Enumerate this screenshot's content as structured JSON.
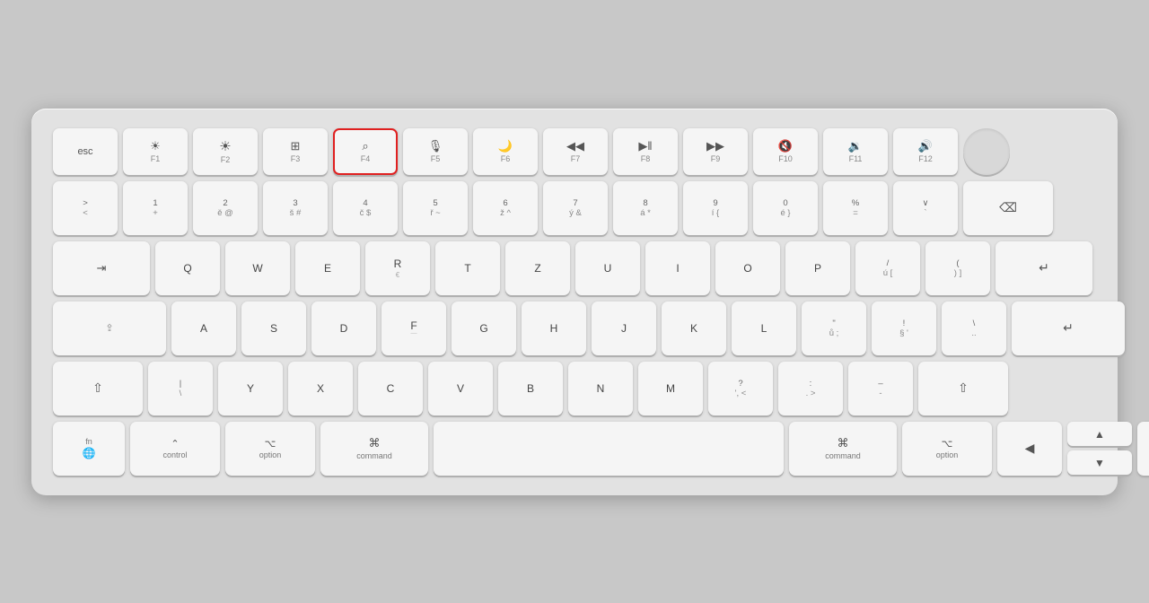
{
  "keyboard": {
    "highlighted_key": "F4",
    "rows": {
      "row1": {
        "keys": [
          {
            "id": "esc",
            "main": "esc",
            "sub": ""
          },
          {
            "id": "f1",
            "icon": "☀",
            "sub": "F1"
          },
          {
            "id": "f2",
            "icon": "☀",
            "sub": "F2"
          },
          {
            "id": "f3",
            "icon": "⊞",
            "sub": "F3"
          },
          {
            "id": "f4",
            "icon": "🔍",
            "sub": "F4",
            "highlighted": true
          },
          {
            "id": "f5",
            "icon": "🎙",
            "sub": "F5"
          },
          {
            "id": "f6",
            "icon": "🌙",
            "sub": "F6"
          },
          {
            "id": "f7",
            "icon": "⏮",
            "sub": "F7"
          },
          {
            "id": "f8",
            "icon": "⏯",
            "sub": "F8"
          },
          {
            "id": "f9",
            "icon": "⏭",
            "sub": "F9"
          },
          {
            "id": "f10",
            "icon": "🔇",
            "sub": "F10"
          },
          {
            "id": "f11",
            "icon": "🔉",
            "sub": "F11"
          },
          {
            "id": "f12",
            "icon": "🔊",
            "sub": "F12"
          }
        ]
      }
    }
  }
}
